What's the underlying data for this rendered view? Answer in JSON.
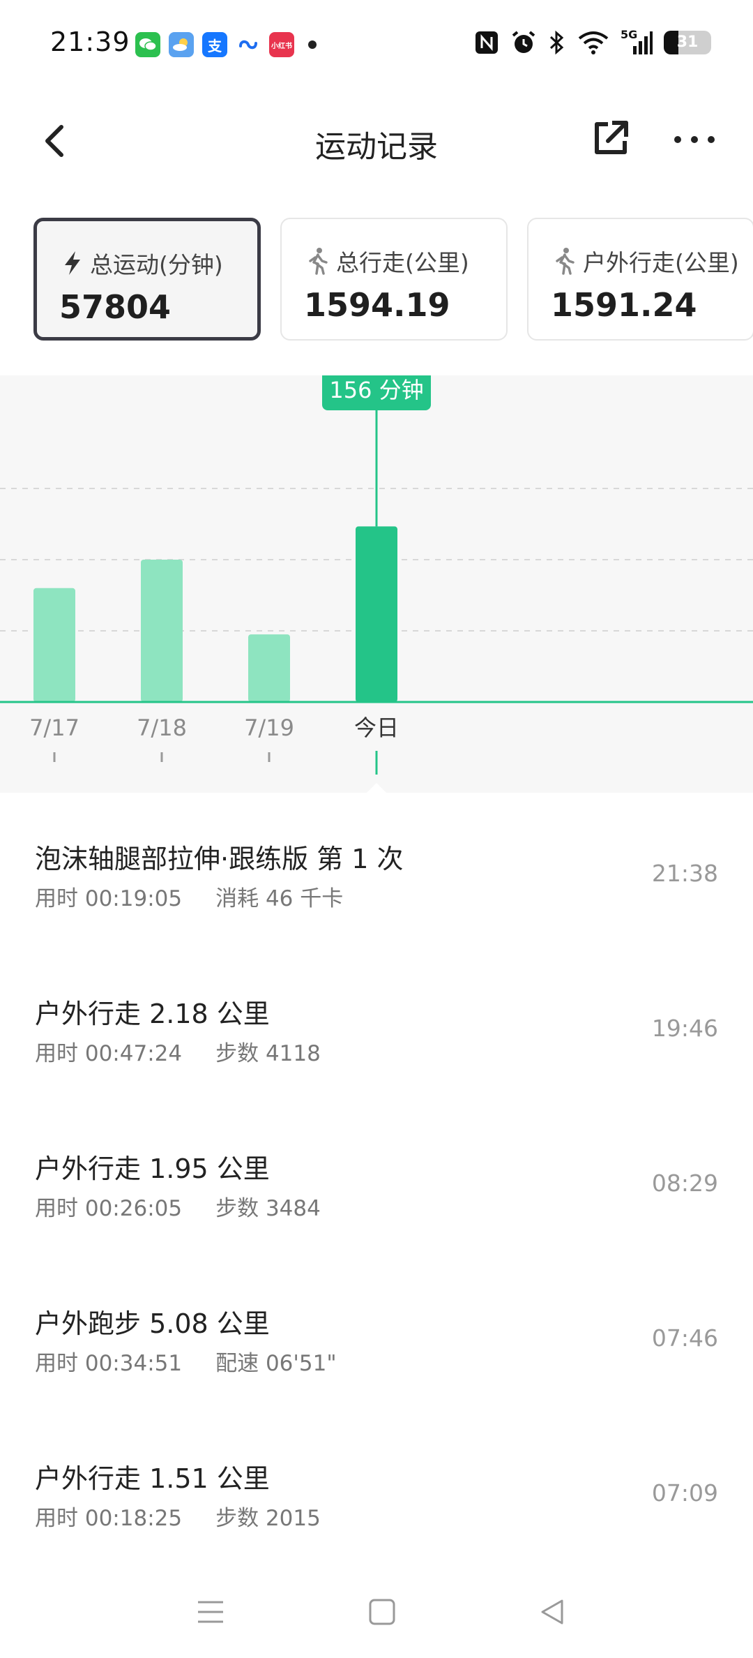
{
  "status_bar": {
    "time": "21:39",
    "apps": [
      {
        "icon": "wechat-icon",
        "color": "#2cc04f",
        "glyph": "✉"
      },
      {
        "icon": "weather-icon",
        "color": "#5aa2f0",
        "glyph": "☁"
      },
      {
        "icon": "alipay-icon",
        "color": "#1677ff",
        "glyph": "支"
      },
      {
        "icon": "cloud-drive-icon",
        "color": "#ffffff",
        "glyph": "∞"
      },
      {
        "icon": "xiaohongshu-icon",
        "color": "#e8344e",
        "glyph": "小红书"
      }
    ],
    "battery_level": "31",
    "network": "5G"
  },
  "header": {
    "title": "运动记录"
  },
  "cards": [
    {
      "label": "总运动(分钟)",
      "value": "57804",
      "icon": "lightning-icon",
      "active": true
    },
    {
      "label": "总行走(公里)",
      "value": "1594.19",
      "icon": "walking-icon",
      "active": false
    },
    {
      "label": "户外行走(公里)",
      "value": "1591.24",
      "icon": "walking-icon",
      "active": false
    }
  ],
  "chart_data": {
    "type": "bar",
    "categories": [
      "7/17",
      "7/18",
      "7/19",
      "今日"
    ],
    "values": [
      96,
      120,
      57,
      148
    ],
    "selected_index": 3,
    "tooltip": "156 分钟",
    "ylim": [
      0,
      240
    ],
    "grid": true,
    "colors": {
      "bar": "#8ee4c0",
      "selected": "#24c488",
      "baseline": "#24c488"
    }
  },
  "records": [
    {
      "title": "泡沫轴腿部拉伸·跟练版 第 1 次",
      "duration": "用时 00:19:05",
      "extra": "消耗 46 千卡",
      "time": "21:38"
    },
    {
      "title": "户外行走 2.18 公里",
      "duration": "用时 00:47:24",
      "extra": "步数 4118",
      "time": "19:46"
    },
    {
      "title": "户外行走 1.95 公里",
      "duration": "用时 00:26:05",
      "extra": "步数 3484",
      "time": "08:29"
    },
    {
      "title": "户外跑步 5.08 公里",
      "duration": "用时 00:34:51",
      "extra": "配速 06'51\"",
      "time": "07:46"
    },
    {
      "title": "户外行走 1.51 公里",
      "duration": "用时 00:18:25",
      "extra": "步数 2015",
      "time": "07:09"
    }
  ]
}
